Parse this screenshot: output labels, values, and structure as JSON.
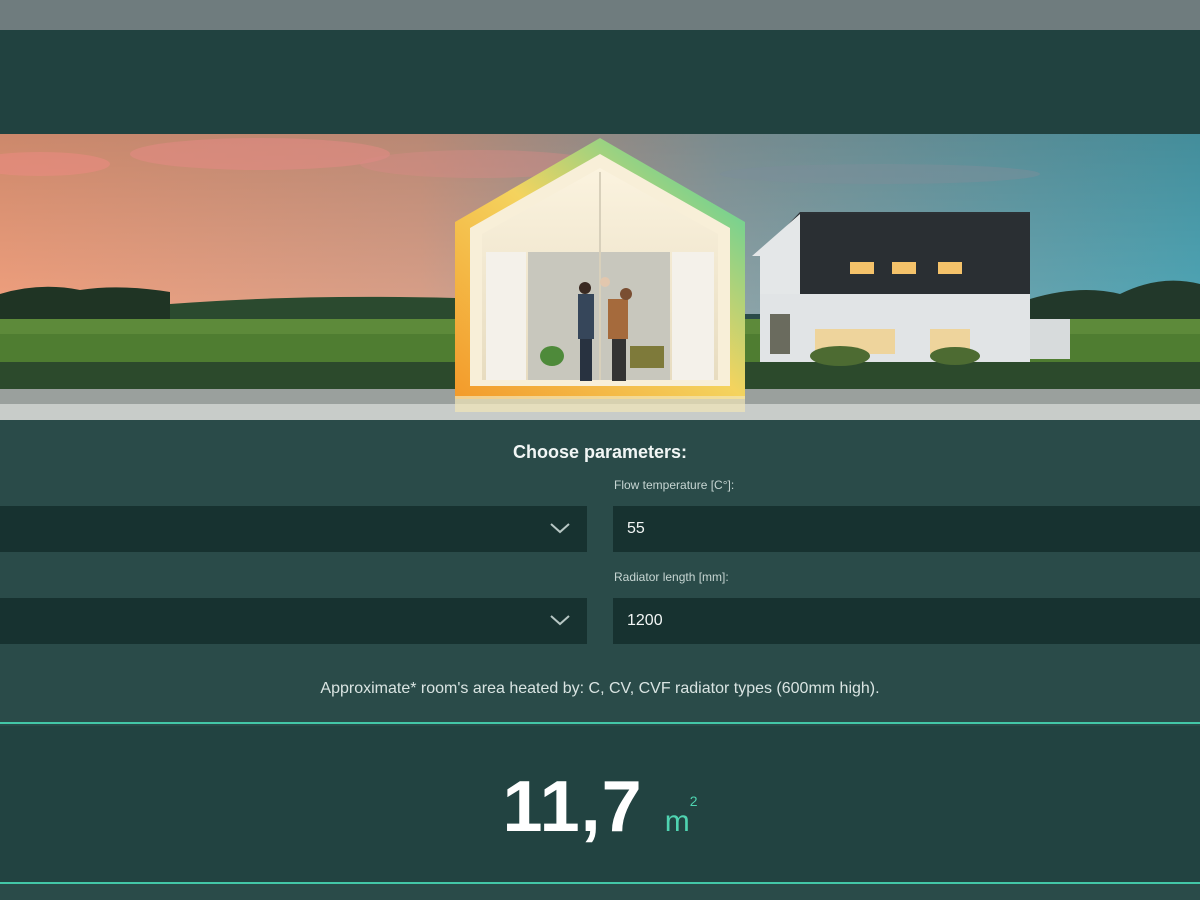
{
  "form": {
    "title": "Choose parameters:",
    "flow_temperature": {
      "label": "Flow temperature [C°]:",
      "value": "55"
    },
    "radiator_length": {
      "label": "Radiator length [mm]:",
      "value": "1200"
    },
    "left_select_1": {
      "value": ""
    },
    "left_select_2": {
      "value": ""
    }
  },
  "note": "Approximate* room's area heated by: C, CV, CVF radiator types (600mm high).",
  "result": {
    "value": "11,7",
    "unit": "m",
    "unit_exp": "2"
  },
  "colors": {
    "background": "#2a4b49",
    "field": "#173230",
    "accent": "#43c7a7"
  },
  "icons": {
    "select_chevron": "chevron-down-icon"
  }
}
